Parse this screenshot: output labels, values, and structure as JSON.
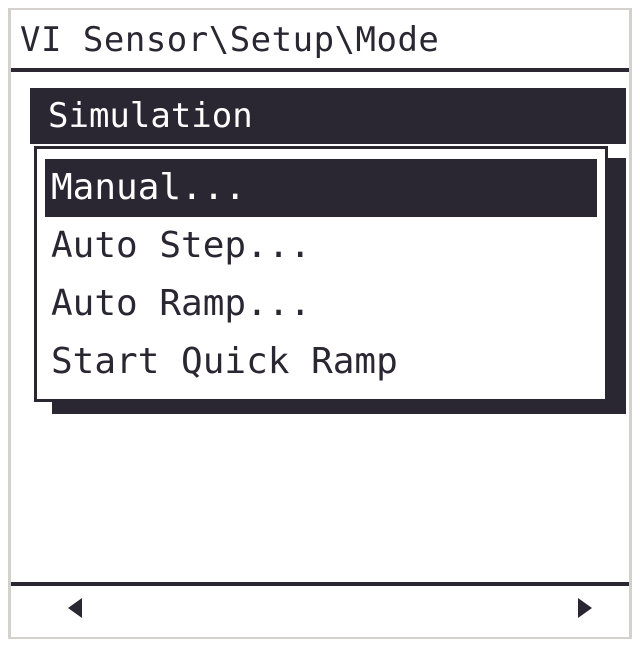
{
  "header": {
    "path": "VI Sensor\\Setup\\Mode"
  },
  "menu": {
    "title": "Simulation",
    "items": [
      {
        "label": "Manual...",
        "selected": true
      },
      {
        "label": "Auto Step...",
        "selected": false
      },
      {
        "label": "Auto Ramp...",
        "selected": false
      },
      {
        "label": "Start Quick Ramp",
        "selected": false
      }
    ]
  },
  "footer": {
    "left_icon": "arrow-left-icon",
    "right_icon": "arrow-right-icon"
  },
  "colors": {
    "foreground": "#2a2733",
    "background": "#ffffff",
    "frame": "#d4d0cc"
  }
}
